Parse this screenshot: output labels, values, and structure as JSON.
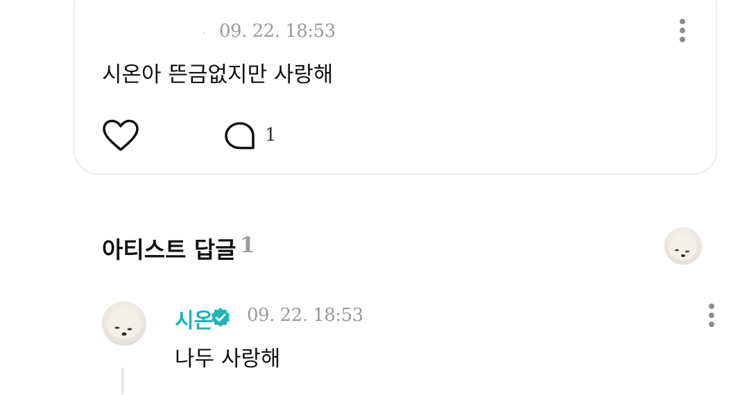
{
  "post": {
    "timestamp": "09. 22. 18:53",
    "text": "시온아 뜬금없지만 사랑해",
    "comment_count": "1",
    "icons": {
      "like": "heart-outline-icon",
      "comment": "speech-bubble-icon",
      "more": "kebab-menu-icon"
    }
  },
  "artist_replies": {
    "title": "아티스트 답글",
    "count": "1"
  },
  "reply": {
    "author": "시온",
    "timestamp": "09. 22. 18:53",
    "text": "나두 사랑해",
    "name_color": "#1cb5b5",
    "verified_color": "#1cb5b5",
    "icons": {
      "verified": "verified-badge-icon",
      "more": "kebab-menu-icon"
    }
  }
}
